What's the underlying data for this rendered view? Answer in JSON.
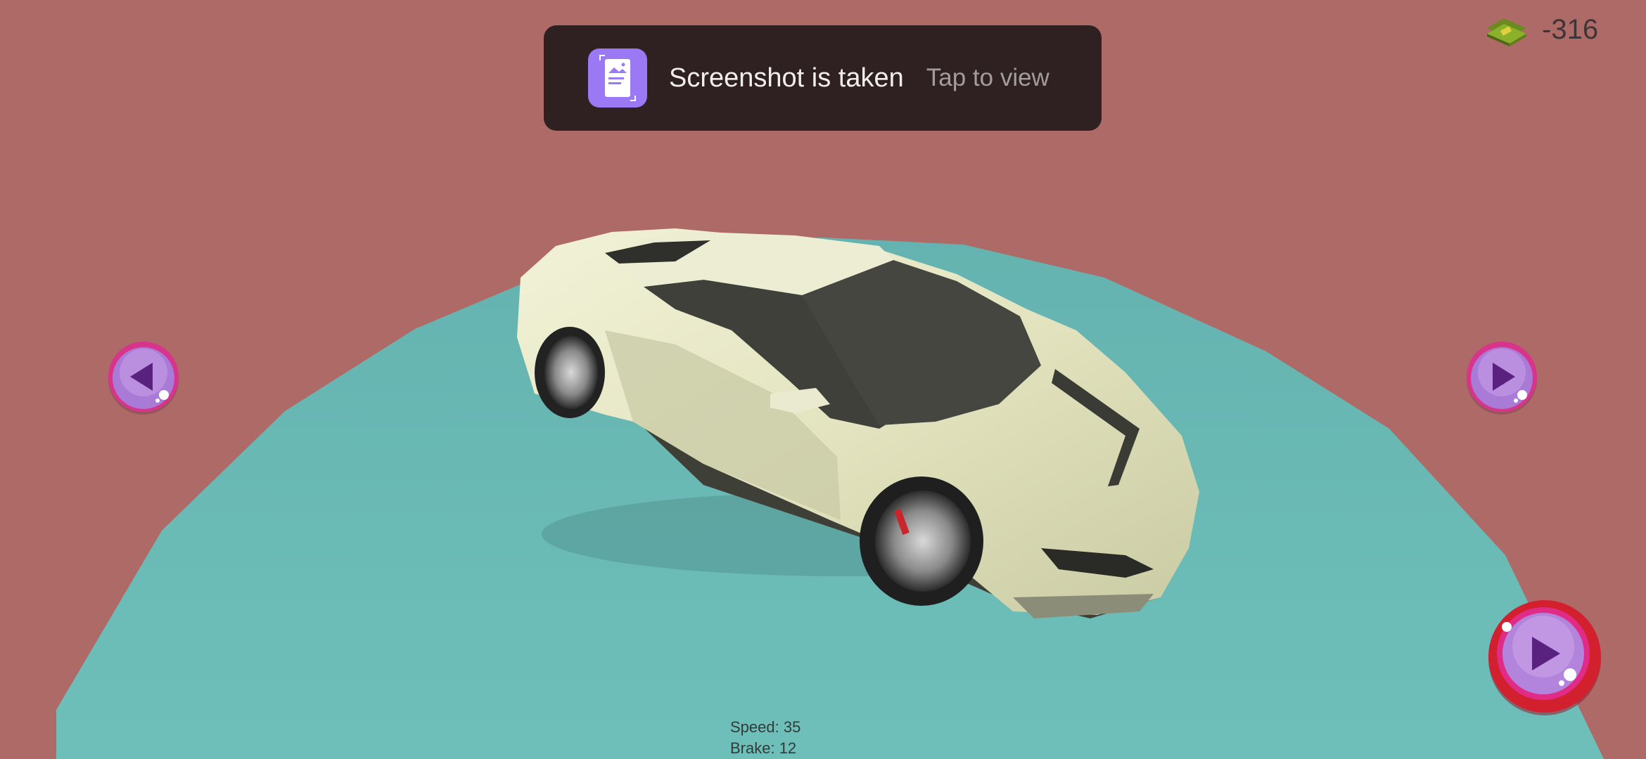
{
  "toast": {
    "title": "Screenshot is taken",
    "action": "Tap to view",
    "icon": "screenshot-gallery-icon"
  },
  "hud": {
    "money_icon": "cash-stack-icon",
    "money_value": "-316"
  },
  "controls": {
    "prev_icon": "triangle-left-icon",
    "next_icon": "triangle-right-icon",
    "play_icon": "play-icon"
  },
  "stats": {
    "speed": "Speed: 35",
    "brake": "Brake: 12"
  },
  "colors": {
    "background": "#ae6a66",
    "platform": "#6ab9b4",
    "car_body": "#e6e7c4",
    "button_purple": "#9c56c4",
    "button_ring": "#c2196b",
    "toast_bg": "#2f2122",
    "toast_icon_bg": "#9b79f4"
  }
}
